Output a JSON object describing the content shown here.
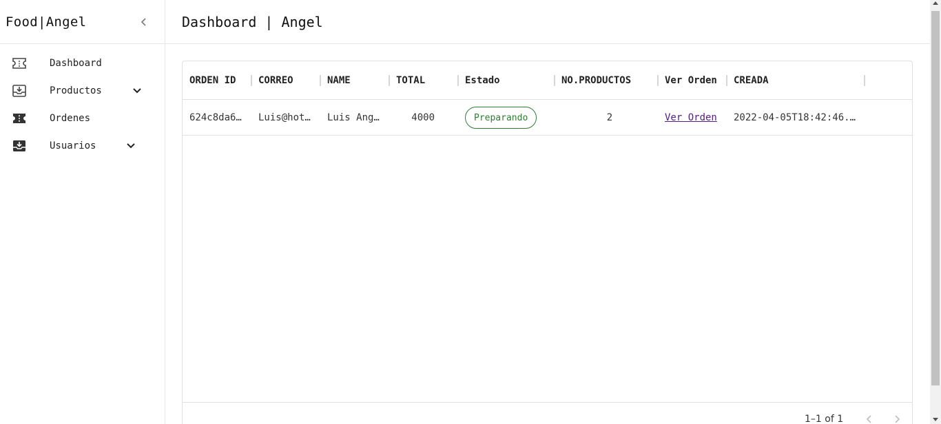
{
  "brand": {
    "name": "Food|Angel"
  },
  "sidebar": {
    "items": [
      {
        "label": "Dashboard",
        "icon": "ticket-icon"
      },
      {
        "label": "Productos",
        "icon": "inbox-arrow-down-icon",
        "expandable": true
      },
      {
        "label": "Ordenes",
        "icon": "ticket-filled-icon"
      },
      {
        "label": "Usuarios",
        "icon": "inbox-arrow-down-icon",
        "expandable": true
      }
    ]
  },
  "header": {
    "title": "Dashboard | Angel"
  },
  "table": {
    "columns": [
      "ORDEN ID",
      "CORREO",
      "NAME",
      "TOTAL",
      "Estado",
      "NO.PRODUCTOS",
      "Ver Orden",
      "CREADA"
    ],
    "rows": [
      {
        "orden_id": "624c8da6…",
        "correo": "Luis@hot…",
        "name": "Luis Ang…",
        "total": "4000",
        "estado": "Preparando",
        "no_productos": "2",
        "ver_orden": "Ver Orden",
        "creada": "2022-04-05T18:42:46.…"
      }
    ],
    "pagination": {
      "range": "1–1 of 1"
    }
  },
  "colors": {
    "status_chip": "#2e7d32",
    "link": "#551a8b",
    "border": "#e0e0e0"
  }
}
